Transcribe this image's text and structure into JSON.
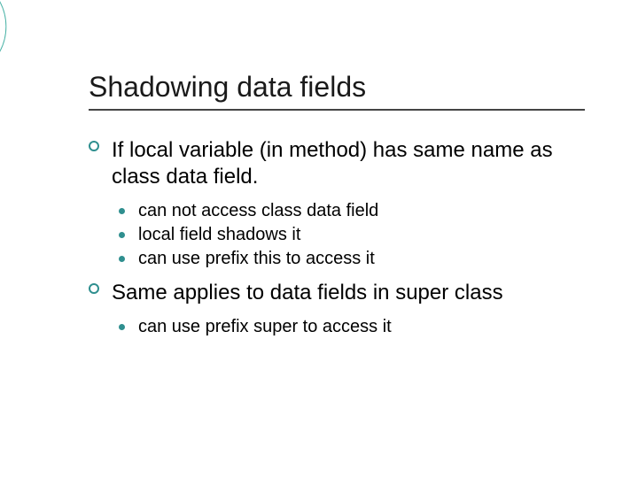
{
  "slide": {
    "title": "Shadowing data fields",
    "items": [
      {
        "text": "If local variable (in method) has same name as class data field.",
        "sub": [
          "can not access class data field",
          "local field shadows it",
          "can use prefix this to access it"
        ]
      },
      {
        "text": "Same applies to data fields in super class",
        "sub": [
          "can use prefix super to access it"
        ]
      }
    ]
  }
}
